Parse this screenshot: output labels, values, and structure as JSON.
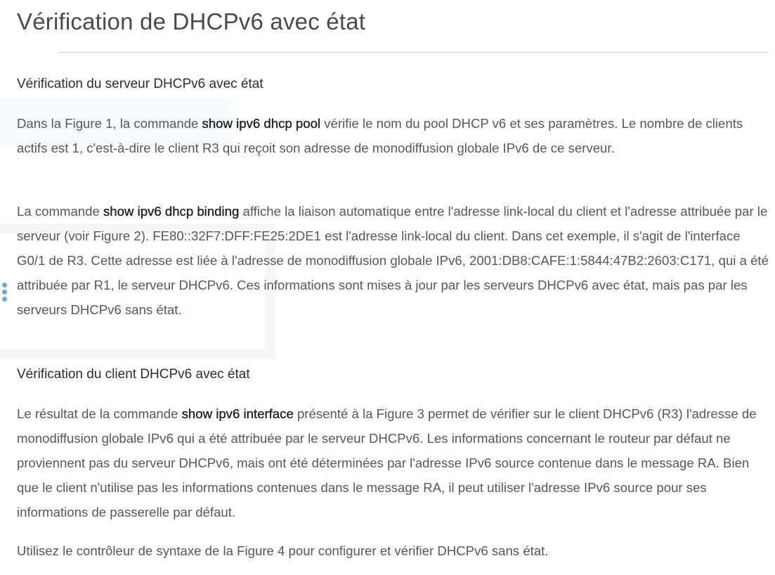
{
  "page": {
    "title": "Vérification de DHCPv6 avec état"
  },
  "sections": [
    {
      "heading": "Vérification du serveur DHCPv6 avec état",
      "paragraphs": [
        {
          "before": "Dans la Figure 1, la commande ",
          "command": "show ipv6 dhcp pool",
          "after": " vérifie le nom du pool DHCP v6 et ses paramètres. Le nombre de clients actifs est 1, c'est-à-dire le client R3 qui reçoit son adresse de monodiffusion globale IPv6 de ce serveur."
        },
        {
          "before": "La commande ",
          "command": "show ipv6 dhcp binding",
          "after": " affiche la liaison automatique entre l'adresse link-local du client et l'adresse attribuée par le serveur (voir Figure 2). FE80::32F7:DFF:FE25:2DE1 est l'adresse link-local du client. Dans cet exemple, il s'agit de l'interface G0/1 de R3. Cette adresse est liée à l'adresse de monodiffusion globale IPv6, 2001:DB8:CAFE:1:5844:47B2:2603:C171, qui a été attribuée par R1, le serveur DHCPv6. Ces informations sont mises à jour par les serveurs DHCPv6 avec état, mais pas par les serveurs DHCPv6 sans état."
        }
      ]
    },
    {
      "heading": "Vérification du client DHCPv6 avec état",
      "paragraphs": [
        {
          "before": "Le résultat de la commande ",
          "command": "show ipv6 interface",
          "after": " présenté à la Figure 3 permet de vérifier sur le client DHCPv6 (R3) l'adresse de monodiffusion globale IPv6 qui a été attribuée par le serveur DHCPv6. Les informations concernant le routeur par défaut ne proviennent pas du serveur DHCPv6, mais ont été déterminées par l'adresse IPv6 source contenue dans le message RA. Bien que le client n'utilise pas les informations contenues dans le message RA, il peut utiliser l'adresse IPv6 source pour ses informations de passerelle par défaut."
        },
        {
          "before": "Utilisez le contrôleur de syntaxe de la Figure 4 pour configurer et vérifier DHCPv6 sans état.",
          "command": "",
          "after": ""
        }
      ]
    }
  ]
}
